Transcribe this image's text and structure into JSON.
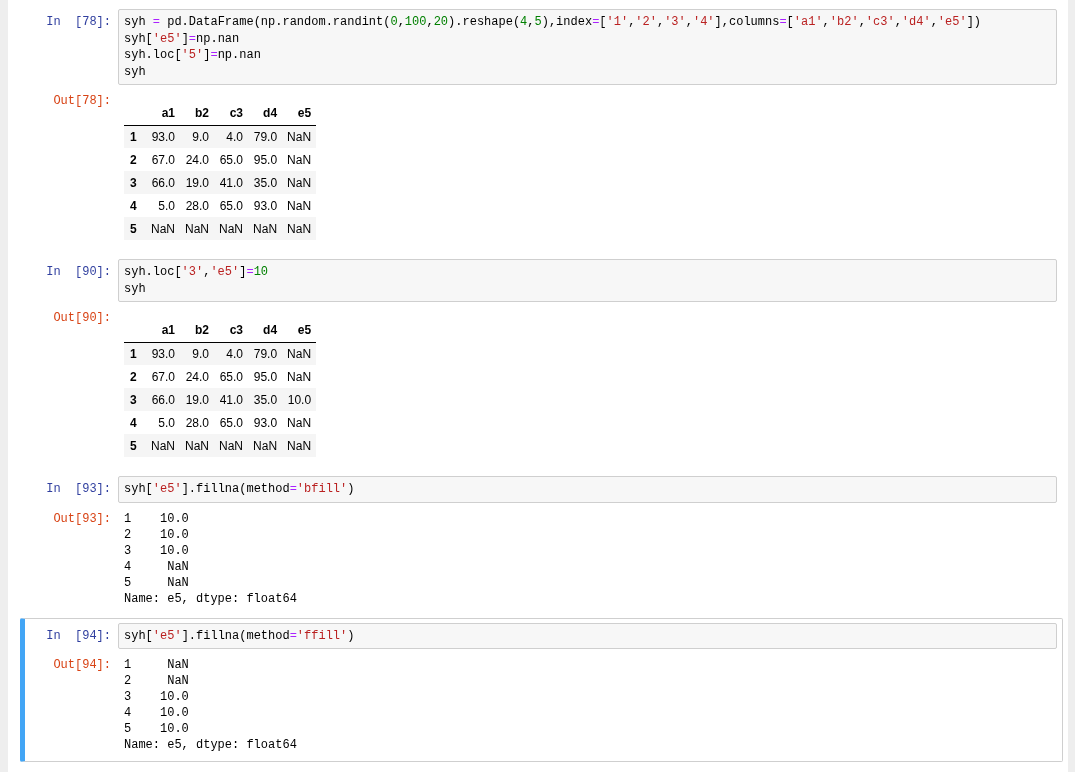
{
  "cells": [
    {
      "in_prompt": "In  [78]:",
      "selected": false,
      "code": [
        "syh = pd.DataFrame(np.random.randint(0,100,20).reshape(4,5),index=['1','2','3','4'],columns=['a1','b2','c3','d4','e5'])",
        "syh['e5']=np.nan",
        "syh.loc['5']=np.nan",
        "syh"
      ],
      "output": {
        "prompt": "Out[78]:",
        "kind": "table",
        "columns": [
          "a1",
          "b2",
          "c3",
          "d4",
          "e5"
        ],
        "rows": [
          {
            "index": "1",
            "cells": [
              "93.0",
              "9.0",
              "4.0",
              "79.0",
              "NaN"
            ]
          },
          {
            "index": "2",
            "cells": [
              "67.0",
              "24.0",
              "65.0",
              "95.0",
              "NaN"
            ]
          },
          {
            "index": "3",
            "cells": [
              "66.0",
              "19.0",
              "41.0",
              "35.0",
              "NaN"
            ]
          },
          {
            "index": "4",
            "cells": [
              "5.0",
              "28.0",
              "65.0",
              "93.0",
              "NaN"
            ]
          },
          {
            "index": "5",
            "cells": [
              "NaN",
              "NaN",
              "NaN",
              "NaN",
              "NaN"
            ]
          }
        ]
      }
    },
    {
      "in_prompt": "In  [90]:",
      "selected": false,
      "code": [
        "syh.loc['3','e5']=10",
        "syh"
      ],
      "output": {
        "prompt": "Out[90]:",
        "kind": "table",
        "columns": [
          "a1",
          "b2",
          "c3",
          "d4",
          "e5"
        ],
        "rows": [
          {
            "index": "1",
            "cells": [
              "93.0",
              "9.0",
              "4.0",
              "79.0",
              "NaN"
            ]
          },
          {
            "index": "2",
            "cells": [
              "67.0",
              "24.0",
              "65.0",
              "95.0",
              "NaN"
            ]
          },
          {
            "index": "3",
            "cells": [
              "66.0",
              "19.0",
              "41.0",
              "35.0",
              "10.0"
            ]
          },
          {
            "index": "4",
            "cells": [
              "5.0",
              "28.0",
              "65.0",
              "93.0",
              "NaN"
            ]
          },
          {
            "index": "5",
            "cells": [
              "NaN",
              "NaN",
              "NaN",
              "NaN",
              "NaN"
            ]
          }
        ]
      }
    },
    {
      "in_prompt": "In  [93]:",
      "selected": false,
      "code": [
        "syh['e5'].fillna(method='bfill')"
      ],
      "output": {
        "prompt": "Out[93]:",
        "kind": "text",
        "lines": [
          "1    10.0",
          "2    10.0",
          "3    10.0",
          "4     NaN",
          "5     NaN",
          "Name: e5, dtype: float64"
        ]
      }
    },
    {
      "in_prompt": "In  [94]:",
      "selected": true,
      "code": [
        "syh['e5'].fillna(method='ffill')"
      ],
      "output": {
        "prompt": "Out[94]:",
        "kind": "text",
        "lines": [
          "1     NaN",
          "2     NaN",
          "3    10.0",
          "4    10.0",
          "5    10.0",
          "Name: e5, dtype: float64"
        ]
      }
    }
  ]
}
